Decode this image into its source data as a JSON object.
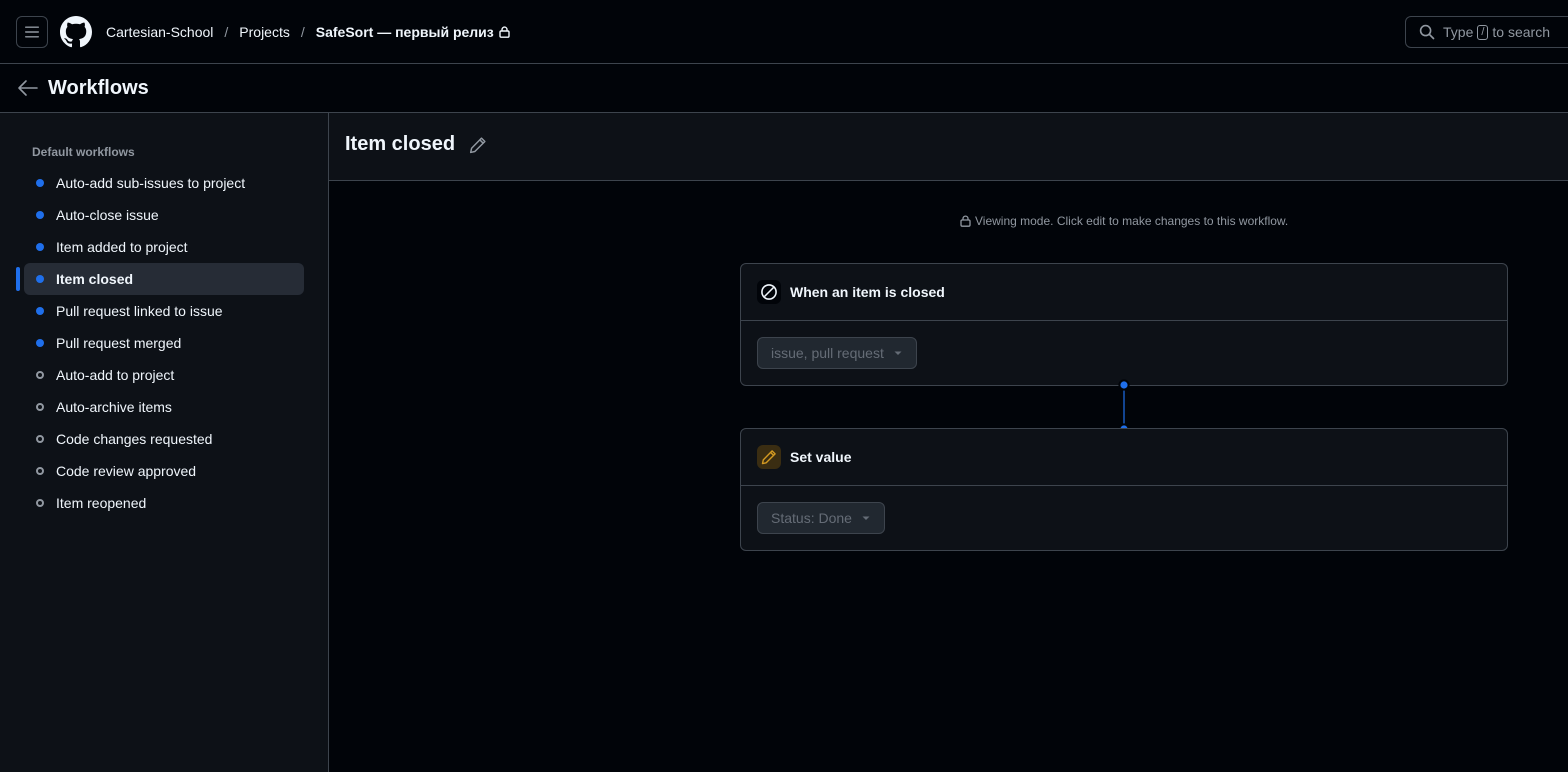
{
  "header": {
    "breadcrumbs": [
      {
        "label": "Cartesian-School"
      },
      {
        "label": "Projects"
      },
      {
        "label": "SafeSort — первый релиз"
      }
    ],
    "search": {
      "prefix": "Type",
      "shortcut": "/",
      "suffix": "to search"
    }
  },
  "page": {
    "title": "Workflows"
  },
  "sidebar": {
    "heading": "Default workflows",
    "items": [
      {
        "label": "Auto-add sub-issues to project",
        "enabled": true
      },
      {
        "label": "Auto-close issue",
        "enabled": true
      },
      {
        "label": "Item added to project",
        "enabled": true
      },
      {
        "label": "Item closed",
        "enabled": true,
        "selected": true
      },
      {
        "label": "Pull request linked to issue",
        "enabled": true
      },
      {
        "label": "Pull request merged",
        "enabled": true
      },
      {
        "label": "Auto-add to project",
        "enabled": false
      },
      {
        "label": "Auto-archive items",
        "enabled": false
      },
      {
        "label": "Code changes requested",
        "enabled": false
      },
      {
        "label": "Code review approved",
        "enabled": false
      },
      {
        "label": "Item reopened",
        "enabled": false
      }
    ]
  },
  "main": {
    "title": "Item closed",
    "viewing_note": "Viewing mode. Click edit to make changes to this workflow.",
    "trigger": {
      "title": "When an item is closed",
      "icon": "circle-slash-icon",
      "filter_value": "issue, pull request"
    },
    "action": {
      "title": "Set value",
      "icon": "pencil-icon",
      "value": "Status: Done"
    }
  },
  "colors": {
    "accent": "#1f6feb",
    "action_icon": "#d29922",
    "background": "#010409",
    "panel": "#0d1117",
    "border": "#3d444d"
  }
}
